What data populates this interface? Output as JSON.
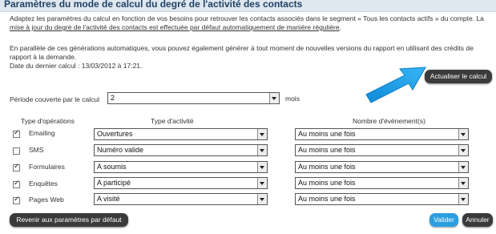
{
  "header": {
    "title": "Paramètres du mode de calcul du degré de l'activité des contacts"
  },
  "intro": {
    "text_1": "Adaptez les paramètres du calcul en fonction de vos besoins pour retrouver les contacts associés dans le segment « Tous les contacts actifs » du compte. La ",
    "text_underlined": "mise à jour du degré de l'activité des contacts est effectuée par défaut automatiquement de manière régulière",
    "text_2": "."
  },
  "para2": {
    "line_1": "En parallèle de ces générations automatiques, vous pouvez également générer à tout moment de nouvelles versions du rapport en utilisant des crédits de rapport à la demande.",
    "line_2": "Date du dernier calcul : 13/03/2012 à 17:21."
  },
  "actions": {
    "refresh_label": "Actualiser le calcul"
  },
  "period": {
    "label": "Période couverte par le calcul",
    "value": "2",
    "unit": "mois"
  },
  "table": {
    "col_operations": "Type d'opérations",
    "col_activity": "Type d'activité",
    "col_events": "Nombre d'événement(s)",
    "rows": [
      {
        "label": "Emailing",
        "checked": true,
        "activity": "Ouvertures",
        "events": "Au moins une fois"
      },
      {
        "label": "SMS",
        "checked": false,
        "activity": "Numéro valide",
        "events": "Au moins une fois"
      },
      {
        "label": "Formulaires",
        "checked": true,
        "activity": "A soumis",
        "events": "Au moins une fois"
      },
      {
        "label": "Enquêtes",
        "checked": true,
        "activity": "A participé",
        "events": "Au moins une fois"
      },
      {
        "label": "Pages Web",
        "checked": true,
        "activity": "A visité",
        "events": "Au moins une fois"
      }
    ]
  },
  "footer": {
    "reset_label": "Revenir aux paramètres par défaut",
    "validate_label": "Valider",
    "cancel_label": "Annuler"
  },
  "colors": {
    "accent_blue": "#2a9fe0",
    "dark_button": "#3b3b3b",
    "header_bg": "#dfe7ef"
  }
}
